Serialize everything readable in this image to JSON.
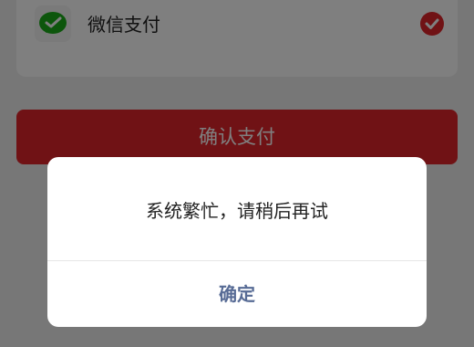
{
  "payment_option": {
    "label": "微信支付",
    "icon": "wechat-pay-icon",
    "selected": true,
    "icon_color": "#07c160",
    "check_color": "#e0242a"
  },
  "confirm_button": {
    "label": "确认支付",
    "color": "#e0242a"
  },
  "dialog": {
    "message": "系统繁忙，请稍后再试",
    "ok_label": "确定",
    "ok_color": "#576b95"
  }
}
